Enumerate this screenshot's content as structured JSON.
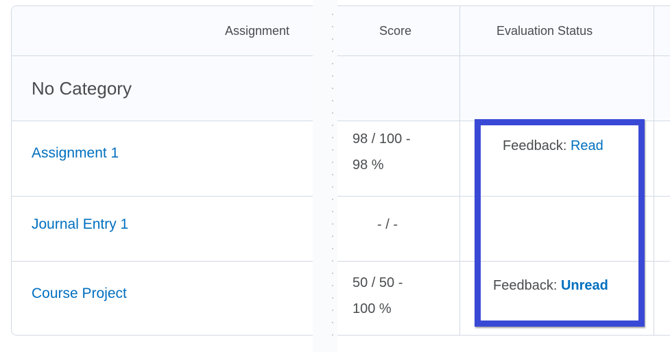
{
  "table": {
    "columns": {
      "assignment": "Assignment",
      "score": "Score",
      "evaluation_status": "Evaluation Status"
    },
    "category": "No Category",
    "rows": [
      {
        "name": "Assignment 1",
        "score_line1": "98 / 100 -",
        "score_line2": "98 %",
        "feedback_label": "Feedback:",
        "feedback_status": "Read"
      },
      {
        "name": "Journal Entry 1",
        "score_line1": "- / -",
        "score_line2": "",
        "feedback_label": "",
        "feedback_status": ""
      },
      {
        "name": "Course Project",
        "score_line1": "50 / 50 -",
        "score_line2": "100 %",
        "feedback_label": "Feedback:",
        "feedback_status": "Unread"
      }
    ]
  },
  "colors": {
    "link": "#006fbf",
    "highlight": "#3949d6",
    "border": "#d3d9e3",
    "header_bg": "#f9fbff"
  }
}
